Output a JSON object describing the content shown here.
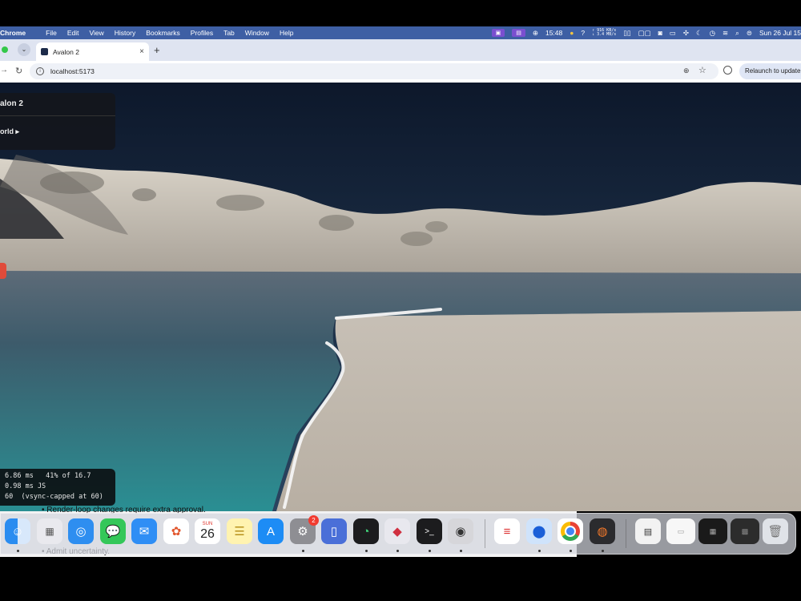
{
  "menubar": {
    "app_name": "Chrome",
    "items": [
      "File",
      "Edit",
      "View",
      "History",
      "Bookmarks",
      "Profiles",
      "Tab",
      "Window",
      "Help"
    ],
    "time": "15:48",
    "net_up": "↑ 916 KB/s",
    "net_down": "↓ 3.4 MB/s",
    "date": "Sun 26 Jul 15"
  },
  "browser": {
    "tab_title": "Avalon 2",
    "new_tab_glyph": "+",
    "tab_close_glyph": "×",
    "url": "localhost:5173",
    "relaunch_label": "Relaunch to update"
  },
  "app": {
    "panel_title": "alon 2",
    "panel_world": "orld ▸",
    "stats": [
      "6.86 ms   41% of 16.7",
      "0.98 ms JS",
      "60  (vsync-capped at 60)"
    ]
  },
  "background_doc": {
    "line1": "• Render-loop changes require extra approval.",
    "line2": "• Admit uncertainty."
  },
  "dock": {
    "calendar_month": "SUN",
    "calendar_day": "26",
    "settings_badge": "2"
  },
  "colors": {
    "menubar": "#3e5fa4",
    "water": "#2a8f93",
    "sand": "#bfb6aa",
    "sky": "#0f1b30"
  }
}
